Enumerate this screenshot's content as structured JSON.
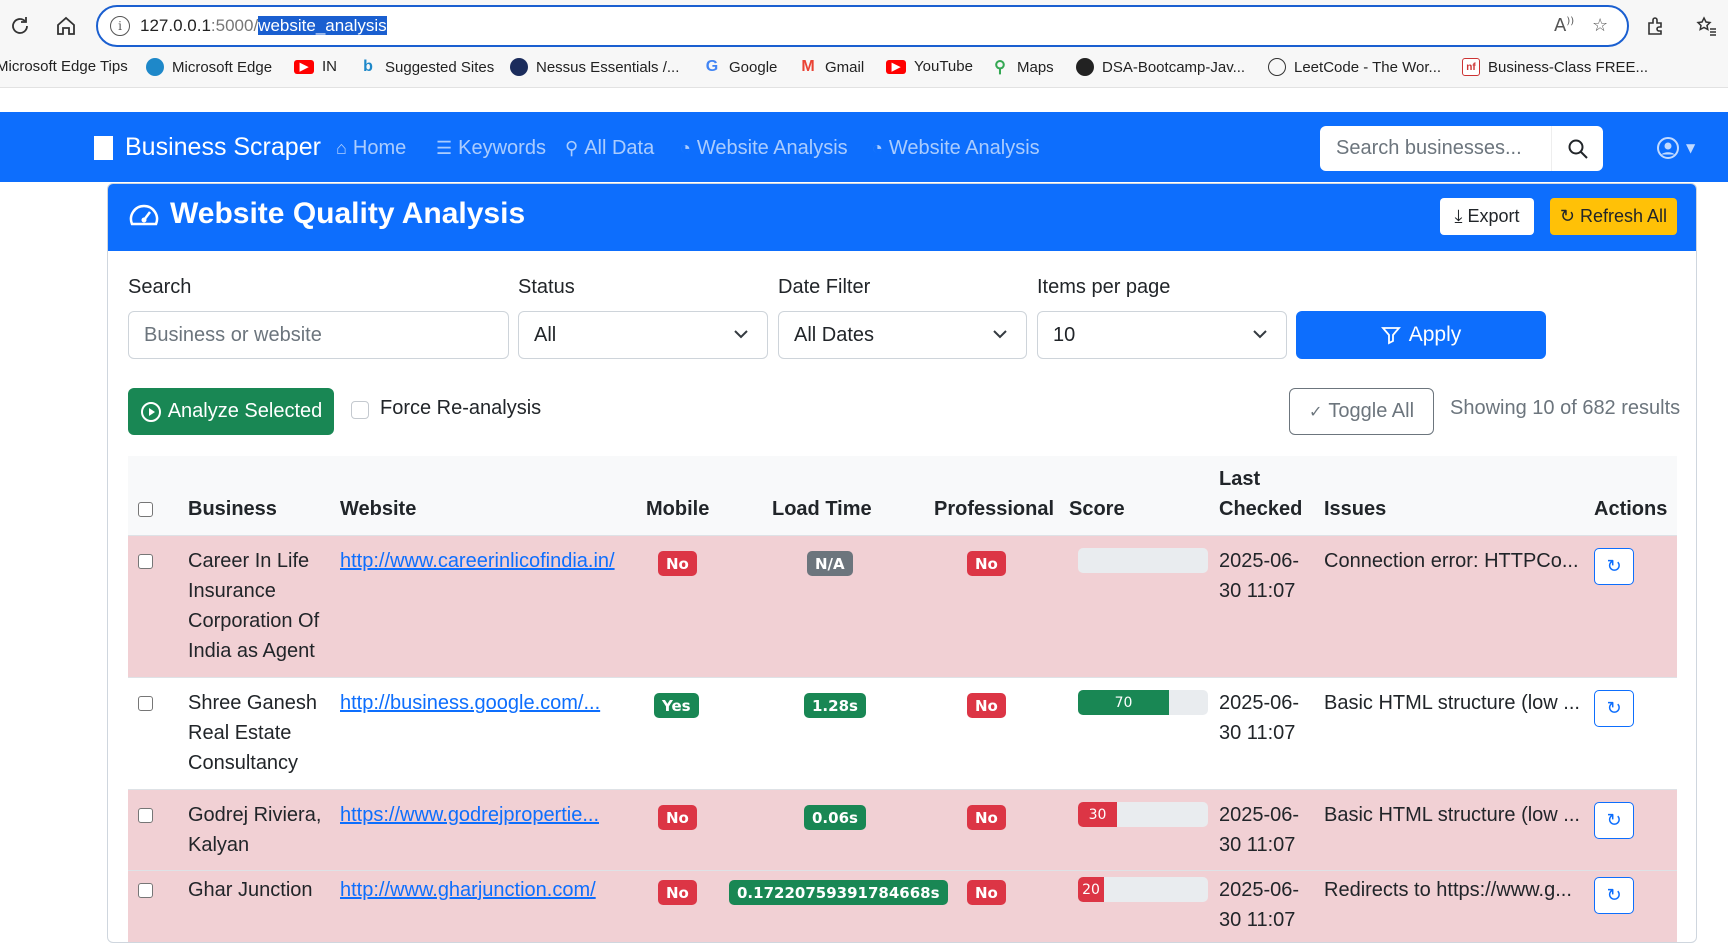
{
  "browser": {
    "url_host": "127.0.0.1",
    "url_port": ":5000/",
    "url_path": "website_analysis",
    "bookmarks": [
      "Microsoft Edge Tips",
      "Microsoft Edge",
      "IN",
      "Suggested Sites",
      "Nessus Essentials /...",
      "Google",
      "Gmail",
      "YouTube",
      "Maps",
      "DSA-Bootcamp-Jav...",
      "LeetCode - The Wor...",
      "Business-Class FREE..."
    ]
  },
  "navbar": {
    "brand": "Business Scraper",
    "links": [
      "Home",
      "Keywords",
      "All Data",
      "Website Analysis",
      "Website Analysis"
    ],
    "search_placeholder": "Search businesses..."
  },
  "card": {
    "title": "Website Quality Analysis",
    "export_label": "Export",
    "refresh_label": "Refresh All"
  },
  "filters": {
    "search_label": "Search",
    "search_placeholder": "Business or website",
    "status_label": "Status",
    "status_value": "All",
    "date_label": "Date Filter",
    "date_value": "All Dates",
    "items_label": "Items per page",
    "items_value": "10",
    "apply_label": "Apply"
  },
  "actions": {
    "analyze_label": "Analyze Selected",
    "force_label": "Force Re-analysis",
    "toggle_label": "Toggle All",
    "showing_text": "Showing 10 of 682 results"
  },
  "table": {
    "headers": {
      "business": "Business",
      "website": "Website",
      "mobile": "Mobile",
      "load_time": "Load Time",
      "professional": "Professional",
      "score": "Score",
      "last_checked_1": "Last",
      "last_checked_2": "Checked",
      "issues": "Issues",
      "actions": "Actions"
    },
    "rows": [
      {
        "business": [
          "Career In Life",
          "Insurance",
          "Corporation Of",
          "India as Agent"
        ],
        "website": "http://www.careerinlicofindia.in/",
        "mobile": "No",
        "load_time": "N/A",
        "professional": "No",
        "score": null,
        "score_label": "",
        "date_1": "2025-06-",
        "date_2": "30 11:07",
        "issues": "Connection error: HTTPCo..."
      },
      {
        "business": [
          "Shree Ganesh",
          "Real Estate",
          "Consultancy"
        ],
        "website": "http://business.google.com/...",
        "mobile": "Yes",
        "load_time": "1.28s",
        "professional": "No",
        "score": 70,
        "score_label": "70",
        "date_1": "2025-06-",
        "date_2": "30 11:07",
        "issues": "Basic HTML structure (low ..."
      },
      {
        "business": [
          "Godrej Riviera,",
          "Kalyan"
        ],
        "website": "https://www.godrejpropertie...",
        "mobile": "No",
        "load_time": "0.06s",
        "professional": "No",
        "score": 30,
        "score_label": "30",
        "date_1": "2025-06-",
        "date_2": "30 11:07",
        "issues": "Basic HTML structure (low ..."
      },
      {
        "business": [
          "Ghar Junction"
        ],
        "website": "http://www.gharjunction.com/",
        "mobile": "No",
        "load_time": "0.17220759391784668s",
        "professional": "No",
        "score": 20,
        "score_label": "20",
        "date_1": "2025-06-",
        "date_2": "30 11:07",
        "issues": "Redirects to https://www.g..."
      }
    ]
  },
  "colors": {
    "primary": "#0d6efd",
    "success": "#198754",
    "danger": "#dc3545",
    "warning": "#ffc107",
    "secondary": "#6c757d",
    "row_danger_bg": "#f1d0d4"
  }
}
